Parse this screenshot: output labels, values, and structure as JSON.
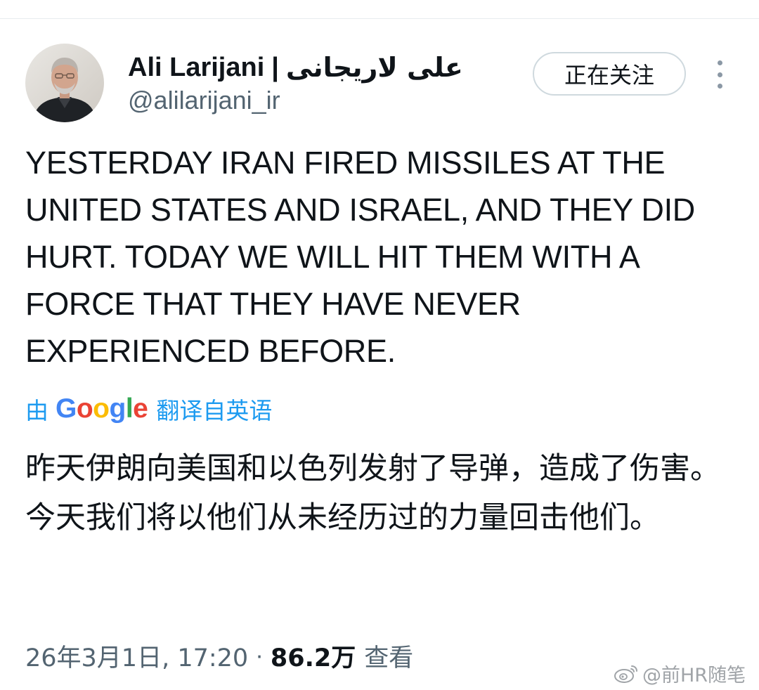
{
  "profile": {
    "display_name": "Ali Larijani",
    "separator": "|",
    "display_name_fa": "علی لاریجانی",
    "handle": "@alilarijani_ir",
    "avatar_icon": "profile-photo"
  },
  "actions": {
    "follow_label": "正在关注",
    "more_icon": "more-vertical-icon"
  },
  "tweet": {
    "text": "YESTERDAY IRAN FIRED MISSILES AT THE UNITED STATES AND ISRAEL, AND THEY DID HURT. TODAY WE WILL HIT THEM WITH A FORCE THAT THEY HAVE NEVER EXPERIENCED BEFORE."
  },
  "translation": {
    "prefix": "由",
    "provider_logo_text": "Google",
    "suffix": "翻译自英语",
    "text": "昨天伊朗向美国和以色列发射了导弹，造成了伤害。今天我们将以他们从未经历过的力量回击他们。"
  },
  "meta": {
    "timestamp": "26年3月1日, 17:20",
    "dot": "·",
    "views_count": "86.2万",
    "views_label": "查看"
  },
  "watermark": {
    "text": "@前HR随笔",
    "icon": "weibo-icon"
  },
  "colors": {
    "link_blue": "#1d9bf0",
    "secondary_text": "#536471",
    "primary_text": "#0f1419",
    "google_blue": "#4285F4",
    "google_red": "#EA4335",
    "google_yellow": "#FBBC05",
    "google_green": "#34A853"
  }
}
